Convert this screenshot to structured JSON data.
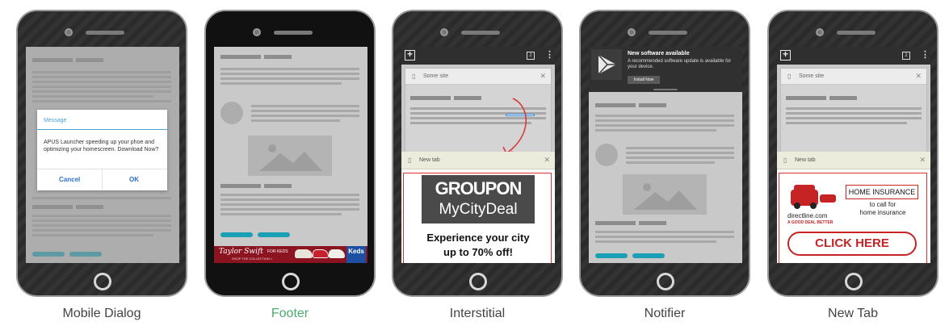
{
  "phones": [
    {
      "label": "Mobile Dialog",
      "dialog": {
        "title": "Message",
        "body": "APUS Launcher speeding up your phoe and optimizing your homescreen. Download Now?",
        "cancel": "Cancel",
        "ok": "OK"
      }
    },
    {
      "label": "Footer",
      "ad": {
        "script_text": "Taylor Swift",
        "script_suffix": "FOR KEDS",
        "small_text": "SHOP THE COLLECTION »",
        "brand": "Keds"
      }
    },
    {
      "label": "Interstitial",
      "tab_title": "Some site",
      "new_tab_title": "New tab",
      "tab_count": "2",
      "ad": {
        "line1": "GROUPON",
        "line2": "MyCityDeal",
        "line3": "Experience your city",
        "line4": "up to 70% off!"
      }
    },
    {
      "label": "Notifier",
      "notification": {
        "title": "New software available",
        "body": "A recommended software update is available for your device.",
        "button": "Install Now"
      }
    },
    {
      "label": "New Tab",
      "tab_title": "Some site",
      "new_tab_title": "New tab",
      "tab_count": "2",
      "ad": {
        "title": "HOME INSURANCE",
        "sub1": "to call for",
        "sub2": "home insurance",
        "brand": "directline.com",
        "tagline": "A GOOD DEAL BETTER",
        "cta": "CLICK HERE"
      }
    }
  ],
  "active_label_color": "#4bab6d",
  "accent_color": "#19a0b4"
}
